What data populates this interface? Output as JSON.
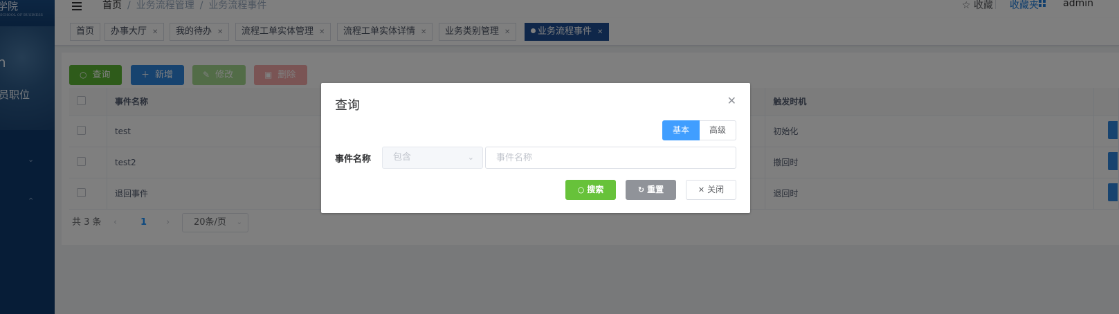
{
  "sidebar": {
    "logo_text": "学院",
    "logo_subtext": "SCHOOL OF BUSINESS",
    "user_name": "n",
    "user_role": "员职位",
    "menu_chevrons": [
      "⌄",
      "⌃"
    ]
  },
  "topbar": {
    "breadcrumb": [
      "首页",
      "业务流程管理",
      "业务流程事件"
    ],
    "favorite_label": "收藏",
    "favorites_dir_label": "收藏夹",
    "user": "admin"
  },
  "tags": [
    {
      "label": "首页",
      "closable": false
    },
    {
      "label": "办事大厅",
      "closable": true
    },
    {
      "label": "我的待办",
      "closable": true
    },
    {
      "label": "流程工单实体管理",
      "closable": true
    },
    {
      "label": "流程工单实体详情",
      "closable": true
    },
    {
      "label": "业务类别管理",
      "closable": true
    },
    {
      "label": "业务流程事件",
      "closable": true,
      "active": true
    }
  ],
  "toolbar": {
    "query_label": "查询",
    "add_label": "新增",
    "edit_label": "修改",
    "delete_label": "删除"
  },
  "table": {
    "columns": [
      "事件名称",
      "触发时机"
    ],
    "rows": [
      {
        "name": "test",
        "trigger": "初始化"
      },
      {
        "name": "test2",
        "trigger": "撤回时"
      },
      {
        "name": "退回事件",
        "trigger": "退回时"
      }
    ]
  },
  "pagination": {
    "total_text": "共 3 条",
    "current_page": "1",
    "page_size": "20条/页"
  },
  "dialog": {
    "title": "查询",
    "mode_basic": "基本",
    "mode_advanced": "高级",
    "field_label": "事件名称",
    "operator_placeholder": "包含",
    "value_placeholder": "事件名称",
    "search_label": "搜索",
    "reset_label": "重置",
    "close_label": "关闭"
  },
  "colors": {
    "sidebar_bg": "#0e3a6e",
    "active_tag": "#1e4f94",
    "success": "#67c23a",
    "primary": "#409eff"
  }
}
